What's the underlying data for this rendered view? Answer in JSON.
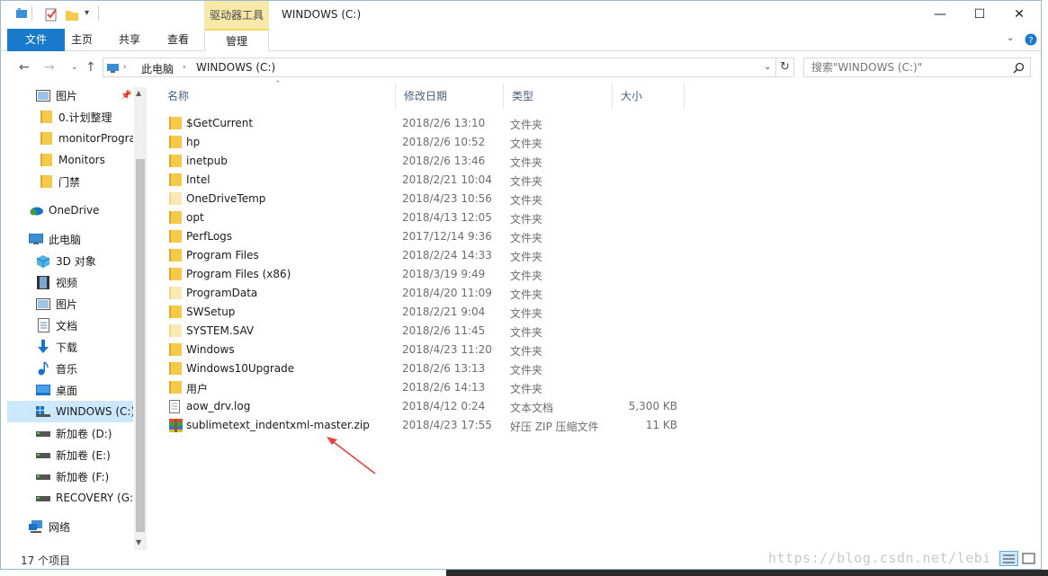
{
  "window": {
    "title": "WINDOWS (C:)",
    "tool_tab": "驱动器工具"
  },
  "controls": {
    "minimize": "—",
    "maximize": "☐",
    "close": "✕"
  },
  "ribbon": {
    "tabs": [
      "文件",
      "主页",
      "共享",
      "查看",
      "管理"
    ]
  },
  "address": {
    "crumbs": [
      "此电脑",
      "WINDOWS (C:)"
    ],
    "search_placeholder": "搜索\"WINDOWS (C:)\""
  },
  "sidebar": {
    "items": [
      {
        "label": "图片",
        "icon": "pictures-icon",
        "pinned": true
      },
      {
        "label": "0.计划整理",
        "icon": "folder-icon"
      },
      {
        "label": "monitorProgra",
        "icon": "folder-icon"
      },
      {
        "label": "Monitors",
        "icon": "folder-icon"
      },
      {
        "label": "门禁",
        "icon": "folder-icon"
      },
      {
        "label": "OneDrive",
        "icon": "onedrive-icon"
      },
      {
        "label": "此电脑",
        "icon": "this-pc-icon"
      },
      {
        "label": "3D 对象",
        "icon": "3d-objects-icon"
      },
      {
        "label": "视频",
        "icon": "videos-icon"
      },
      {
        "label": "图片",
        "icon": "pictures-icon"
      },
      {
        "label": "文档",
        "icon": "documents-icon"
      },
      {
        "label": "下载",
        "icon": "downloads-icon"
      },
      {
        "label": "音乐",
        "icon": "music-icon"
      },
      {
        "label": "桌面",
        "icon": "desktop-icon"
      },
      {
        "label": "WINDOWS (C:)",
        "icon": "drive-windows-icon",
        "selected": true
      },
      {
        "label": "新加卷 (D:)",
        "icon": "drive-icon"
      },
      {
        "label": "新加卷 (E:)",
        "icon": "drive-icon"
      },
      {
        "label": "新加卷 (F:)",
        "icon": "drive-icon"
      },
      {
        "label": "RECOVERY (G:)",
        "icon": "drive-icon"
      },
      {
        "label": "网络",
        "icon": "network-icon"
      }
    ]
  },
  "columns": [
    "名称",
    "修改日期",
    "类型",
    "大小"
  ],
  "files": [
    {
      "name": "$GetCurrent",
      "date": "2018/2/6 13:10",
      "type": "文件夹",
      "size": "",
      "icon": "folder-icon"
    },
    {
      "name": "hp",
      "date": "2018/2/6 10:52",
      "type": "文件夹",
      "size": "",
      "icon": "folder-icon"
    },
    {
      "name": "inetpub",
      "date": "2018/2/6 13:46",
      "type": "文件夹",
      "size": "",
      "icon": "folder-icon"
    },
    {
      "name": "Intel",
      "date": "2018/2/21 10:04",
      "type": "文件夹",
      "size": "",
      "icon": "folder-icon"
    },
    {
      "name": "OneDriveTemp",
      "date": "2018/4/23 10:56",
      "type": "文件夹",
      "size": "",
      "icon": "folder-hidden-icon"
    },
    {
      "name": "opt",
      "date": "2018/4/13 12:05",
      "type": "文件夹",
      "size": "",
      "icon": "folder-icon"
    },
    {
      "name": "PerfLogs",
      "date": "2017/12/14 9:36",
      "type": "文件夹",
      "size": "",
      "icon": "folder-icon"
    },
    {
      "name": "Program Files",
      "date": "2018/2/24 14:33",
      "type": "文件夹",
      "size": "",
      "icon": "folder-icon"
    },
    {
      "name": "Program Files (x86)",
      "date": "2018/3/19 9:49",
      "type": "文件夹",
      "size": "",
      "icon": "folder-icon"
    },
    {
      "name": "ProgramData",
      "date": "2018/4/20 11:09",
      "type": "文件夹",
      "size": "",
      "icon": "folder-hidden-icon"
    },
    {
      "name": "SWSetup",
      "date": "2018/2/21 9:04",
      "type": "文件夹",
      "size": "",
      "icon": "folder-icon"
    },
    {
      "name": "SYSTEM.SAV",
      "date": "2018/2/6 11:45",
      "type": "文件夹",
      "size": "",
      "icon": "folder-hidden-icon"
    },
    {
      "name": "Windows",
      "date": "2018/4/23 11:20",
      "type": "文件夹",
      "size": "",
      "icon": "folder-icon"
    },
    {
      "name": "Windows10Upgrade",
      "date": "2018/2/6 13:13",
      "type": "文件夹",
      "size": "",
      "icon": "folder-icon"
    },
    {
      "name": "用户",
      "date": "2018/2/6 14:13",
      "type": "文件夹",
      "size": "",
      "icon": "folder-icon"
    },
    {
      "name": "aow_drv.log",
      "date": "2018/4/12 0:24",
      "type": "文本文档",
      "size": "5,300 KB",
      "icon": "text-file-icon"
    },
    {
      "name": "sublimetext_indentxml-master.zip",
      "date": "2018/4/23 17:55",
      "type": "好压 ZIP 压缩文件",
      "size": "11 KB",
      "icon": "zip-archive-icon"
    }
  ],
  "status": {
    "count_text": "17 个项目"
  },
  "watermark": "https://blog.csdn.net/lebi",
  "colors": {
    "file_tab": "#1979ca",
    "tool_tab": "#f7e9a8",
    "selected": "#cce8ff",
    "folder": "#f5c94a",
    "arrow": "#e8423a"
  }
}
